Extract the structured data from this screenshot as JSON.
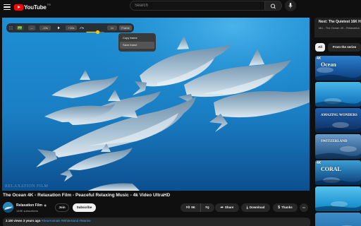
{
  "header": {
    "logo_text": "YouTube",
    "logo_region": "TR",
    "search_placeholder": "Search"
  },
  "player": {
    "watermark": "RELAXATION FILM",
    "extension": {
      "minus_label": "—",
      "back_label": "-10s",
      "fwd_label": "+10s",
      "speed_label": "1x",
      "speed_level": 0.65,
      "frame_label": "Frame",
      "menu_items": [
        "Copy frame",
        "Save frame"
      ]
    }
  },
  "video": {
    "title": "The Ocean 4K - Relaxation Film - Peaceful Relaxing Music - 4k Video UltraHD",
    "channel": "Relaxation Film",
    "verified_mark": "◉",
    "subscribers": "149K subscribers",
    "join_label": "Join",
    "subscribe_label": "Subscribe",
    "likes": "9K",
    "share_label": "Share",
    "download_label": "Download",
    "thanks_label": "Thanks",
    "more_label": "•••",
    "views": "2.1M views",
    "age": "3 years ago",
    "tags": "#SeaAnimals #WhiteSand #Marine"
  },
  "sidebar": {
    "playlist_title": "Next: The Quietest 16K HD",
    "playlist_sub": "Mix - The Ocean 4K - Relaxation",
    "chips": [
      "All",
      "From the series"
    ],
    "thumbnails": [
      {
        "title": "Ocean",
        "badge": "4K",
        "colors": [
          "#0b3d7a",
          "#2a7fd0"
        ]
      },
      {
        "title": "",
        "badge": "",
        "colors": [
          "#0a6cb8",
          "#49b6e8"
        ]
      },
      {
        "title": "AMAZING WONDERS",
        "badge": "",
        "colors": [
          "#0d2e5c",
          "#1e5fae"
        ]
      },
      {
        "title": "SWITZERLAND",
        "badge": "",
        "colors": [
          "#1a4a7a",
          "#6a9ccc"
        ]
      },
      {
        "title": "CORAL",
        "badge": "4K",
        "colors": [
          "#0a3a74",
          "#3aa0d8"
        ]
      },
      {
        "title": "",
        "badge": "",
        "colors": [
          "#0a84c6",
          "#58c3ee"
        ]
      },
      {
        "title": "",
        "badge": "",
        "colors": [
          "#1a6aa8",
          "#3f8ec8"
        ]
      }
    ]
  },
  "colors": {
    "background": "#0f0f0f",
    "brand_red": "#ff0000",
    "link_blue": "#3ea6ff",
    "speed_accent": "#f5c518"
  }
}
